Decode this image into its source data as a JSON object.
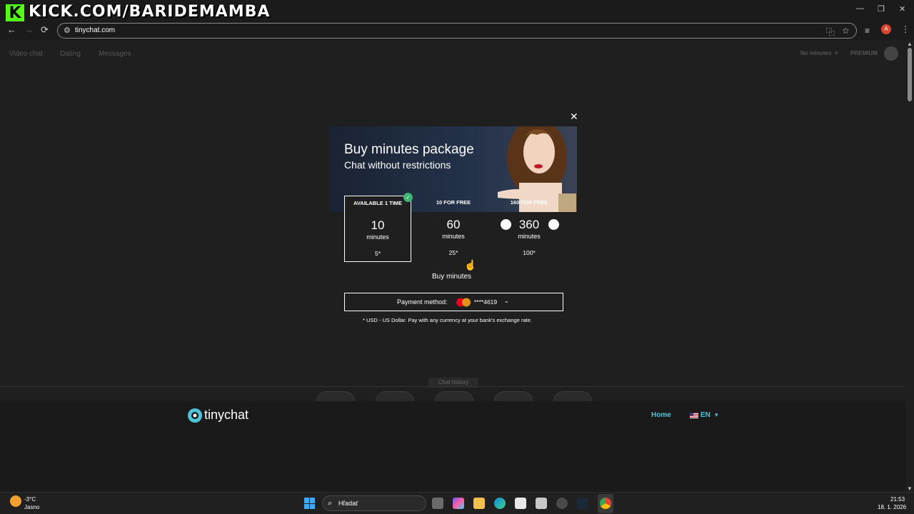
{
  "stream_overlay": {
    "logo_letter": "K",
    "banner": "KICK.COM/BARIDEMAMBA"
  },
  "window": {
    "minimize": "—",
    "restore": "❐",
    "close": "✕"
  },
  "browser": {
    "back": "←",
    "forward": "→",
    "reload": "⟳",
    "url": "tinychat.com",
    "profile_initial": "A",
    "menu": "⋮"
  },
  "site": {
    "nav": [
      "Video chat",
      "Dating",
      "Messages"
    ],
    "minutes_status": "No minutes",
    "add_label": "+",
    "premium_label": "PREMIUM"
  },
  "modal": {
    "close": "✕",
    "title": "Buy minutes package",
    "subtitle": "Chat without restrictions",
    "packages": [
      {
        "tag": "AVAILABLE 1 TIME",
        "amount": "10",
        "unit": "minutes",
        "price": "5*",
        "selected": true
      },
      {
        "tag": "10 FOR FREE",
        "amount": "60",
        "unit": "minutes",
        "price": "25*",
        "selected": false
      },
      {
        "tag": "160 FOR FREE",
        "amount": "360",
        "unit": "minutes",
        "price": "100*",
        "selected": false
      }
    ],
    "selected_check": "✓",
    "buy_label": "Buy minutes",
    "payment": {
      "label": "Payment method:",
      "card": "****4619",
      "chevron": "⌄",
      "brand_colors": [
        "#eb001b",
        "#f79e1b"
      ]
    },
    "note": "* USD - US Dollar. Pay with any currency at your bank's exchange rate."
  },
  "footer": {
    "chat_history": "Chat history",
    "brand": "tinychat",
    "home": "Home",
    "language": "EN",
    "lang_chevron": "▾",
    "accent": "#4fc3d6"
  },
  "taskbar": {
    "temperature": "-3°C",
    "weather": "Jasno",
    "search_placeholder": "Hľadať",
    "time": "21:53",
    "date": "18. 1. 2026"
  }
}
